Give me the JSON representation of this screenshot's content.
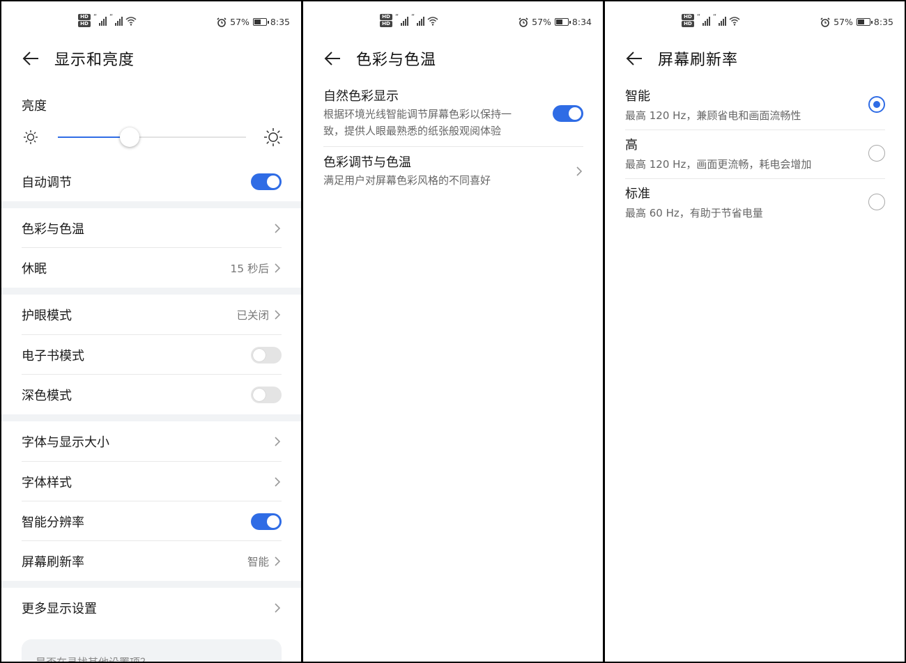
{
  "colors": {
    "accent": "#2f6ce5",
    "section_gap": "#f1f3f5",
    "toggle_off": "#e4e4e4"
  },
  "status_bars": [
    {
      "hd1": "HD",
      "hd2": "HD",
      "battery": "57%",
      "time": "8:35"
    },
    {
      "hd1": "HD",
      "hd2": "HD",
      "battery": "57%",
      "time": "8:34"
    },
    {
      "hd1": "HD",
      "hd2": "HD",
      "battery": "57%",
      "time": "8:35"
    }
  ],
  "display": {
    "title": "显示和亮度",
    "brightness_label": "亮度",
    "brightness_level": 0.38,
    "auto_adjust": {
      "label": "自动调节",
      "on": true
    },
    "color_temp": {
      "label": "色彩与色温"
    },
    "sleep": {
      "label": "休眠",
      "value": "15 秒后"
    },
    "eye_comfort": {
      "label": "护眼模式",
      "value": "已关闭"
    },
    "ebook_mode": {
      "label": "电子书模式",
      "on": false
    },
    "dark_mode": {
      "label": "深色模式",
      "on": false
    },
    "font_size": {
      "label": "字体与显示大小"
    },
    "font_style": {
      "label": "字体样式"
    },
    "smart_resolution": {
      "label": "智能分辨率",
      "on": true
    },
    "refresh_rate": {
      "label": "屏幕刷新率",
      "value": "智能"
    },
    "more": {
      "label": "更多显示设置"
    },
    "search_hint": "是否在寻找其他设置项？"
  },
  "color": {
    "title": "色彩与色温",
    "natural": {
      "title": "自然色彩显示",
      "desc_line1": "根据环境光线智能调节屏幕色彩以保持一",
      "desc_line2": "致，提供人眼最熟悉的纸张般观阅体验",
      "on": true
    },
    "adjust": {
      "title": "色彩调节与色温",
      "desc": "满足用户对屏幕色彩风格的不同喜好"
    }
  },
  "refresh": {
    "title": "屏幕刷新率",
    "options": [
      {
        "title": "智能",
        "desc": "最高 120 Hz，兼顾省电和画面流畅性",
        "selected": true
      },
      {
        "title": "高",
        "desc": "最高 120 Hz，画面更流畅，耗电会增加",
        "selected": false
      },
      {
        "title": "标准",
        "desc": "最高 60 Hz，有助于节省电量",
        "selected": false
      }
    ]
  }
}
